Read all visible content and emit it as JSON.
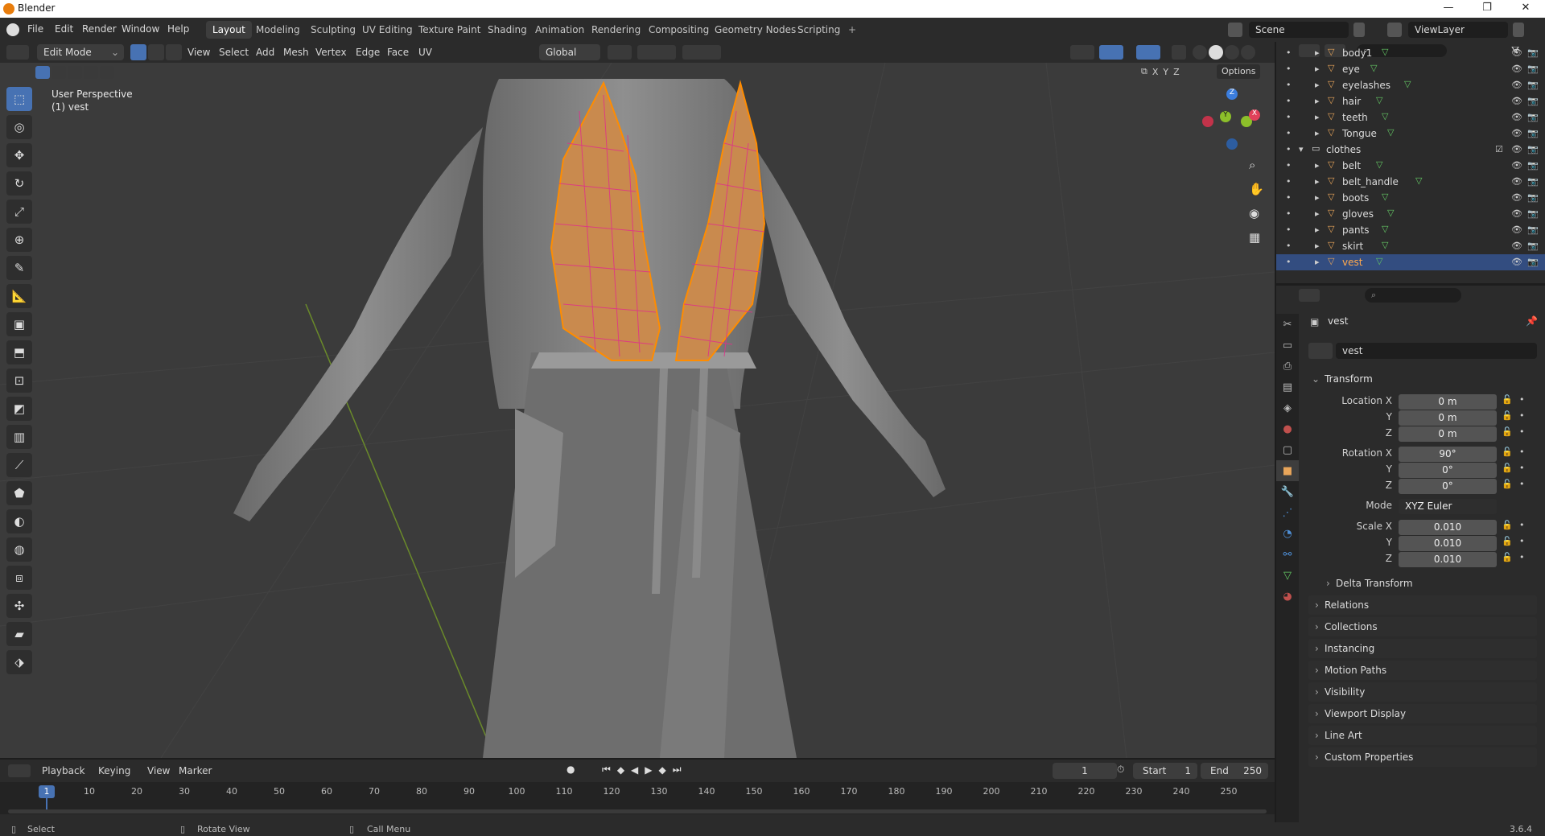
{
  "window": {
    "title": "Blender",
    "min": "—",
    "max": "❐",
    "close": "✕"
  },
  "menus": [
    "File",
    "Edit",
    "Render",
    "Window",
    "Help"
  ],
  "workspaces": [
    "Layout",
    "Modeling",
    "Sculpting",
    "UV Editing",
    "Texture Paint",
    "Shading",
    "Animation",
    "Rendering",
    "Compositing",
    "Geometry Nodes",
    "Scripting"
  ],
  "workspace_add": "+",
  "scene": {
    "name": "Scene",
    "view_layer": "ViewLayer"
  },
  "viewport_header": {
    "mode": "Edit Mode",
    "menus": [
      "View",
      "Select",
      "Add",
      "Mesh",
      "Vertex",
      "Edge",
      "Face",
      "UV"
    ],
    "transform_orientation": "Global",
    "options": "Options",
    "axes": [
      "X",
      "Y",
      "Z"
    ]
  },
  "viewport_overlay": {
    "line1": "User Perspective",
    "line2": "(1) vest"
  },
  "gizmo": {
    "x": "X",
    "y": "Y",
    "z": "Z"
  },
  "outliner": {
    "rows": [
      {
        "name": "body1",
        "type": "mesh",
        "indent": 2
      },
      {
        "name": "eye",
        "type": "mesh",
        "indent": 2
      },
      {
        "name": "eyelashes",
        "type": "mesh",
        "indent": 2
      },
      {
        "name": "hair",
        "type": "mesh",
        "indent": 2
      },
      {
        "name": "teeth",
        "type": "mesh",
        "indent": 2
      },
      {
        "name": "Tongue",
        "type": "mesh",
        "indent": 2
      },
      {
        "name": "clothes",
        "type": "collection",
        "indent": 1
      },
      {
        "name": "belt",
        "type": "mesh",
        "indent": 2
      },
      {
        "name": "belt_handle",
        "type": "mesh",
        "indent": 2
      },
      {
        "name": "boots",
        "type": "mesh",
        "indent": 2
      },
      {
        "name": "gloves",
        "type": "mesh",
        "indent": 2
      },
      {
        "name": "pants",
        "type": "mesh",
        "indent": 2
      },
      {
        "name": "skirt",
        "type": "mesh",
        "indent": 2
      },
      {
        "name": "vest",
        "type": "mesh",
        "indent": 2,
        "selected": true
      }
    ]
  },
  "properties": {
    "object_name": "vest",
    "data_name": "vest",
    "transform_title": "Transform",
    "location": {
      "label": "Location X",
      "x": "0 m",
      "y": "0 m",
      "z": "0 m"
    },
    "rotation": {
      "label": "Rotation X",
      "x": "90°",
      "y": "0°",
      "z": "0°"
    },
    "mode_label": "Mode",
    "mode_value": "XYZ Euler",
    "scale": {
      "label": "Scale X",
      "x": "0.010",
      "y": "0.010",
      "z": "0.010"
    },
    "axis_y": "Y",
    "axis_z": "Z",
    "panels": [
      "Delta Transform",
      "Relations",
      "Collections",
      "Instancing",
      "Motion Paths",
      "Visibility",
      "Viewport Display",
      "Line Art",
      "Custom Properties"
    ]
  },
  "timeline": {
    "menus": [
      "Playback",
      "Keying",
      "View",
      "Marker"
    ],
    "current_frame": "1",
    "start_label": "Start",
    "start": "1",
    "end_label": "End",
    "end": "250",
    "ticks": [
      "1",
      "10",
      "20",
      "30",
      "40",
      "50",
      "60",
      "70",
      "80",
      "90",
      "100",
      "110",
      "120",
      "130",
      "140",
      "150",
      "160",
      "170",
      "180",
      "190",
      "200",
      "210",
      "220",
      "230",
      "240",
      "250"
    ]
  },
  "statusbar": {
    "select": "Select",
    "rotate": "Rotate View",
    "call_menu": "Call Menu",
    "version": "3.6.4"
  },
  "colors": {
    "accent": "#4772b3",
    "selection_orange": "#ff8c00",
    "vertex_pink": "#e0308a",
    "mesh_icon": "#e8a55a",
    "data_icon": "#64c864"
  }
}
